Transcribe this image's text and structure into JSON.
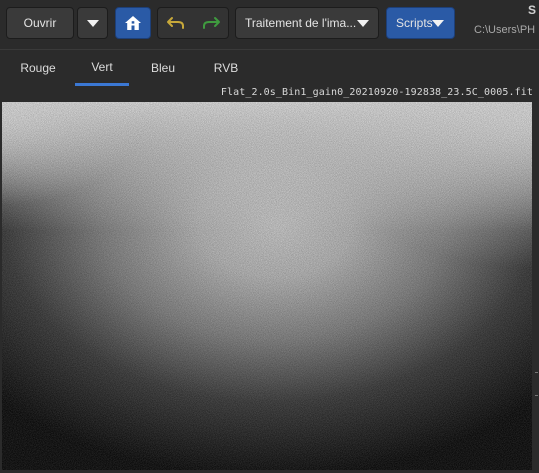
{
  "toolbar": {
    "open_label": "Ouvrir",
    "image_processing_label": "Traitement de l'ima...",
    "scripts_label": "Scripts",
    "path_text": "C:\\Users\\PH",
    "path_partial_char": "S"
  },
  "tabs": [
    {
      "label": "Rouge",
      "active": false
    },
    {
      "label": "Vert",
      "active": true
    },
    {
      "label": "Bleu",
      "active": false
    },
    {
      "label": "RVB",
      "active": false
    }
  ],
  "image": {
    "filename": "Flat_2.0s_Bin1_gain0_20210920-192838_23.5C_0005.fit"
  },
  "colors": {
    "accent": "#3b78d4",
    "button_blue": "#2a5aa6",
    "background": "#2b2b2b",
    "undo_arrow": "#c7a83a",
    "redo_arrow": "#3f9a3f"
  },
  "icons": [
    "dropdown-caret-icon",
    "home-icon",
    "undo-icon",
    "redo-icon"
  ]
}
